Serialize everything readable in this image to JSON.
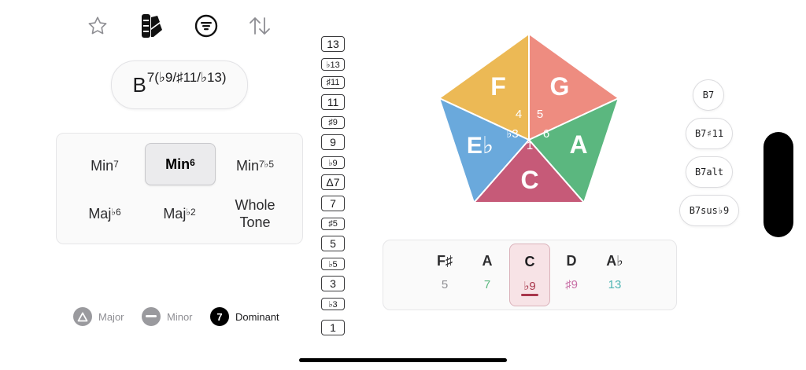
{
  "toolbar": {
    "icons": [
      "star-icon",
      "palette-icon",
      "filter-icon",
      "sort-icon"
    ]
  },
  "chord": {
    "root": "B",
    "extension": "7(♭9/♯11/♭13)"
  },
  "scales": [
    {
      "name": "Min",
      "sup": "7",
      "selected": false
    },
    {
      "name": "Min",
      "sup": "6",
      "selected": true
    },
    {
      "name": "Min",
      "sup": "7♭5",
      "selected": false
    },
    {
      "name": "Maj",
      "sup": "♭6",
      "selected": false
    },
    {
      "name": "Maj",
      "sup": "♭2",
      "selected": false
    },
    {
      "name": "Whole Tone",
      "sup": "",
      "selected": false
    }
  ],
  "legend": [
    {
      "label": "Major",
      "symbol": "△",
      "color": "#9a9a9e",
      "text_color": "#8e8e93"
    },
    {
      "label": "Minor",
      "symbol": "—",
      "color": "#9a9a9e",
      "text_color": "#8e8e93"
    },
    {
      "label": "Dominant",
      "symbol": "7",
      "color": "#000000",
      "text_color": "#1c1c1e"
    }
  ],
  "intervals": [
    "13",
    "♭13",
    "♯11",
    "11",
    "♯9",
    "9",
    "♭9",
    "Δ7",
    "7",
    "♯5",
    "5",
    "♭5",
    "3",
    "♭3",
    "1"
  ],
  "pentagon": {
    "segments": [
      {
        "note": "F",
        "color": "#ecb955",
        "degree": "4"
      },
      {
        "note": "G",
        "color": "#ee8c80",
        "degree": "5"
      },
      {
        "note": "A",
        "color": "#5bb77f",
        "degree": "6"
      },
      {
        "note": "C",
        "color": "#c65a78",
        "degree": "1"
      },
      {
        "note": "E♭",
        "color": "#6aa9dc",
        "degree": "♭3"
      }
    ]
  },
  "notes": [
    {
      "name": "F♯",
      "interval": "5",
      "color": "#8e8e93",
      "selected": false
    },
    {
      "name": "A",
      "interval": "7",
      "color": "#5bb77f",
      "selected": false
    },
    {
      "name": "C",
      "interval": "♭9",
      "color": "#a8364b",
      "selected": true
    },
    {
      "name": "D",
      "interval": "♯9",
      "color": "#c86fa6",
      "selected": false
    },
    {
      "name": "A♭",
      "interval": "13",
      "color": "#4fb5b3",
      "selected": false
    }
  ],
  "chord_options": [
    "B7",
    "B7♯11",
    "B7alt",
    "B7sus♭9"
  ]
}
